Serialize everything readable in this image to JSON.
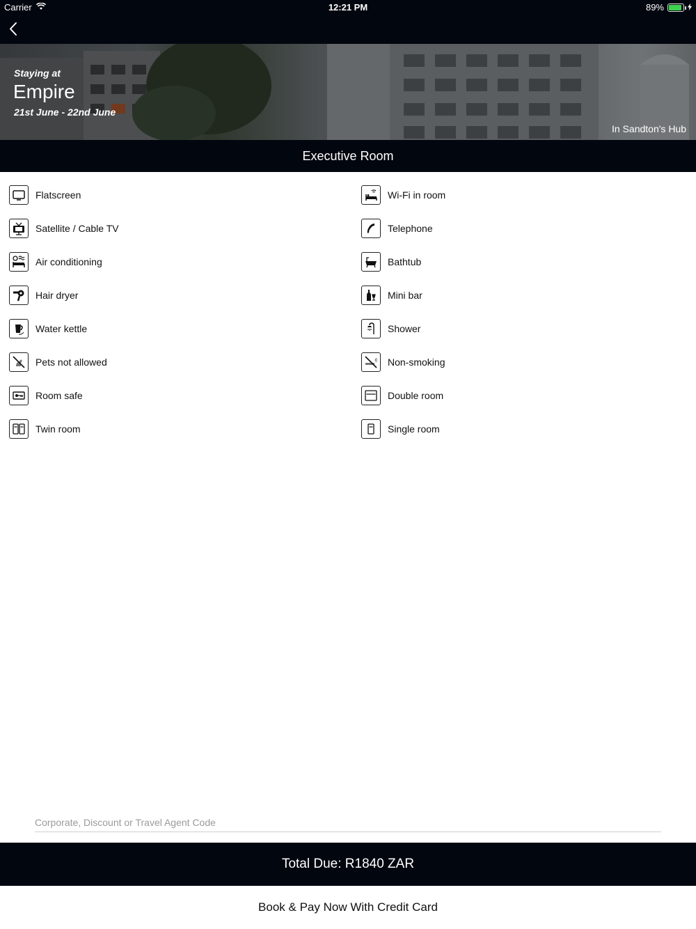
{
  "status_bar": {
    "carrier": "Carrier",
    "time": "12:21 PM",
    "battery_percent": "89%",
    "battery_level": 0.89
  },
  "nav": {
    "back_icon": "chevron-left-icon"
  },
  "hero": {
    "staying_label": "Staying at",
    "hotel_name": "Empire",
    "dates": "21st June - 22nd June",
    "location": "In Sandton's Hub"
  },
  "room": {
    "title": "Executive Room"
  },
  "amenities": {
    "left": [
      {
        "label": "Flatscreen",
        "icon": "flatscreen-icon"
      },
      {
        "label": "Satellite / Cable TV",
        "icon": "satellite-tv-icon"
      },
      {
        "label": "Air conditioning",
        "icon": "air-conditioning-icon"
      },
      {
        "label": "Hair dryer",
        "icon": "hair-dryer-icon"
      },
      {
        "label": "Water kettle",
        "icon": "water-kettle-icon"
      },
      {
        "label": "Pets not allowed",
        "icon": "no-pets-icon"
      },
      {
        "label": "Room safe",
        "icon": "room-safe-icon"
      },
      {
        "label": "Twin room",
        "icon": "twin-room-icon"
      }
    ],
    "right": [
      {
        "label": "Wi-Fi in room",
        "icon": "wifi-room-icon"
      },
      {
        "label": "Telephone",
        "icon": "telephone-icon"
      },
      {
        "label": "Bathtub",
        "icon": "bathtub-icon"
      },
      {
        "label": "Mini bar",
        "icon": "mini-bar-icon"
      },
      {
        "label": "Shower",
        "icon": "shower-icon"
      },
      {
        "label": "Non-smoking",
        "icon": "non-smoking-icon"
      },
      {
        "label": "Double room",
        "icon": "double-room-icon"
      },
      {
        "label": "Single room",
        "icon": "single-room-icon"
      }
    ]
  },
  "code_input": {
    "placeholder": "Corporate, Discount or Travel Agent Code",
    "value": ""
  },
  "total": {
    "label": "Total Due: R1840 ZAR"
  },
  "book_button": {
    "label": "Book & Pay Now With Credit Card"
  }
}
